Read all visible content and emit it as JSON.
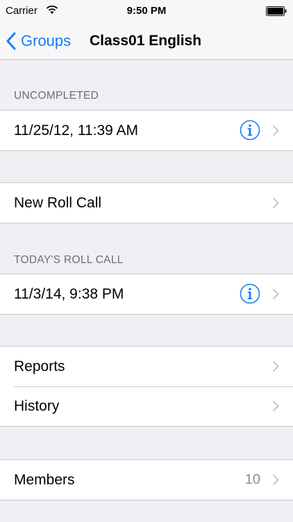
{
  "status_bar": {
    "carrier": "Carrier",
    "time": "9:50 PM"
  },
  "nav": {
    "back_label": "Groups",
    "title": "Class01 English"
  },
  "sections": {
    "uncompleted": {
      "header": "UNCOMPLETED",
      "item": "11/25/12, 11:39 AM"
    },
    "new_roll_call": {
      "item": "New Roll Call"
    },
    "todays_roll_call": {
      "header": "TODAY'S ROLL CALL",
      "item": "11/3/14, 9:38 PM"
    },
    "reports_history": {
      "reports": "Reports",
      "history": "History"
    },
    "members": {
      "label": "Members",
      "count": "10"
    }
  },
  "colors": {
    "accent": "#157efb",
    "background": "#efeff4",
    "separator": "#c8c7cc",
    "secondary_text": "#8e8e93"
  }
}
